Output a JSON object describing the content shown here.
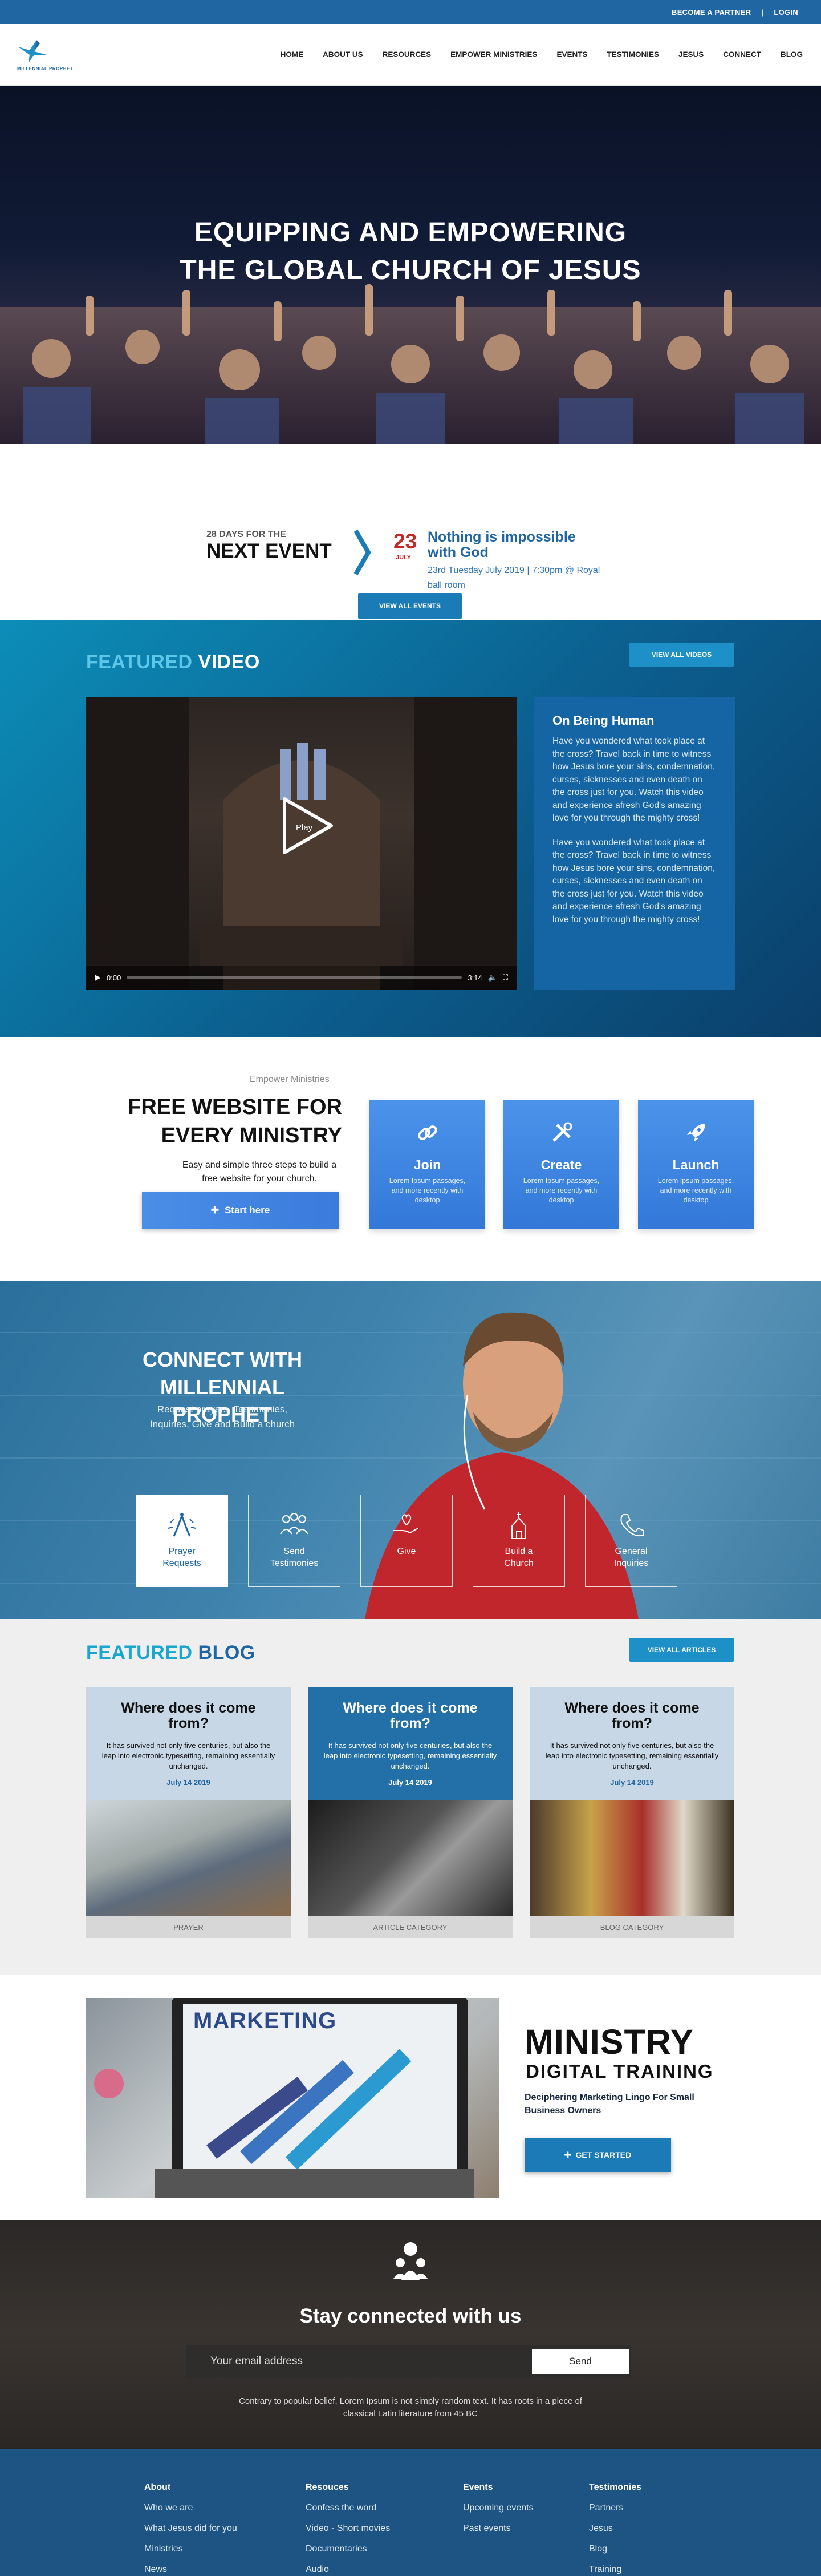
{
  "topbar": {
    "partner": "BECOME A PARTNER",
    "sep": "|",
    "login": "LOGIN"
  },
  "logo": {
    "text": "MILLENNIAL PROPHET"
  },
  "nav": [
    "HOME",
    "ABOUT US",
    "RESOURCES",
    "EMPOWER MINISTRIES",
    "EVENTS",
    "TESTIMONIES",
    "JESUS",
    "CONNECT",
    "BLOG"
  ],
  "hero": {
    "line1": "EQUIPPING AND EMPOWERING",
    "line2": "THE GLOBAL CHURCH OF JESUS"
  },
  "event": {
    "days": "28 DAYS FOR THE",
    "next": "NEXT EVENT",
    "day": "23",
    "month": "JULY",
    "title": "Nothing is impossible with God",
    "detail": "23rd Tuesday July 2019 | 7:30pm @ Royal ball room",
    "button": "VIEW ALL EVENTS"
  },
  "video": {
    "title_hl": "FEATURED",
    "title": "VIDEO",
    "button": "VIEW ALL VIDEOS",
    "play_label": "Play",
    "time_current": "0:00",
    "time_total": "3:14",
    "card_title": "On Being Human",
    "para1": "Have you wondered what took place at the cross? Travel back in time to witness how Jesus bore your sins, condemnation, curses, sicknesses and even death on the cross just for you. Watch this video and experience afresh God's amazing love for you through the mighty cross!",
    "para2": "Have you wondered what took place at the cross? Travel back in time to witness how Jesus bore your sins, condemnation, curses, sicknesses and even death on the cross just for you. Watch this video and experience afresh God's amazing love for you through the mighty cross!"
  },
  "empower": {
    "kicker": "Empower Ministries",
    "title1": "FREE WEBSITE FOR",
    "title2": "EVERY MINISTRY",
    "sub": "Easy and simple three steps to build a free website  for your church.",
    "button": "Start here",
    "steps": [
      {
        "title": "Join",
        "text": "Lorem Ipsum passages, and more recently with desktop"
      },
      {
        "title": "Create",
        "text": "Lorem Ipsum passages, and more recently with desktop"
      },
      {
        "title": "Launch",
        "text": "Lorem Ipsum passages, and more recently with desktop"
      }
    ]
  },
  "connect": {
    "title1": "CONNECT WITH",
    "title2": "MILLENNIAL PROPHET",
    "sub": "Request prayers, Testimonies, Inquiries, Give and Build a church",
    "tiles": [
      {
        "l1": "Prayer",
        "l2": "Requests"
      },
      {
        "l1": "Send",
        "l2": "Testimonies"
      },
      {
        "l1": "Give",
        "l2": ""
      },
      {
        "l1": "Build a",
        "l2": "Church"
      },
      {
        "l1": "General",
        "l2": "Inquiries"
      }
    ]
  },
  "blog": {
    "title_hl": "FEATURED",
    "title": "BLOG",
    "button": "VIEW ALL ARTICLES",
    "cards": [
      {
        "title": "Where does it come from?",
        "text": "It has survived not only five centuries, but also the leap into electronic typesetting, remaining essentially unchanged.",
        "date": "July 14 2019",
        "category": "PRAYER"
      },
      {
        "title": "Where does it come from?",
        "text": "It has survived not only five centuries, but also the leap into electronic typesetting, remaining essentially unchanged.",
        "date": "July 14 2019",
        "category": "ARTICLE CATEGORY"
      },
      {
        "title": "Where does it come from?",
        "text": "It has survived not only five centuries, but also the leap into electronic typesetting, remaining essentially unchanged.",
        "date": "July 14 2019",
        "category": "BLOG CATEGORY"
      }
    ]
  },
  "ministry": {
    "screen_word": "MARKETING",
    "title": "MINISTRY",
    "sub": "DIGITAL  TRAINING",
    "desc": "Deciphering Marketing Lingo For Small Business Owners",
    "button": "GET STARTED"
  },
  "stay": {
    "title": "Stay connected with us",
    "placeholder": "Your email address",
    "send": "Send",
    "note": "Contrary to popular belief, Lorem Ipsum is not simply random text. It has roots in a piece of classical Latin literature from 45 BC"
  },
  "footer": [
    {
      "head": "About",
      "items": [
        "Who we are",
        "What Jesus did for you",
        "Ministries",
        "News"
      ]
    },
    {
      "head": "Resouces",
      "items": [
        "Confess the word",
        "Video - Short movies",
        "Documentaries",
        "Audio"
      ]
    },
    {
      "head": "Events",
      "items": [
        "Upcoming events",
        "Past events"
      ]
    },
    {
      "head": "Testimonies",
      "items": [
        "Partners",
        "Jesus",
        "Blog",
        "Training"
      ]
    }
  ],
  "colors": {
    "brand": "#1f66a3",
    "accent": "#19a6cf",
    "event_red": "#c62828",
    "step_blue": "#3a7bdb"
  }
}
